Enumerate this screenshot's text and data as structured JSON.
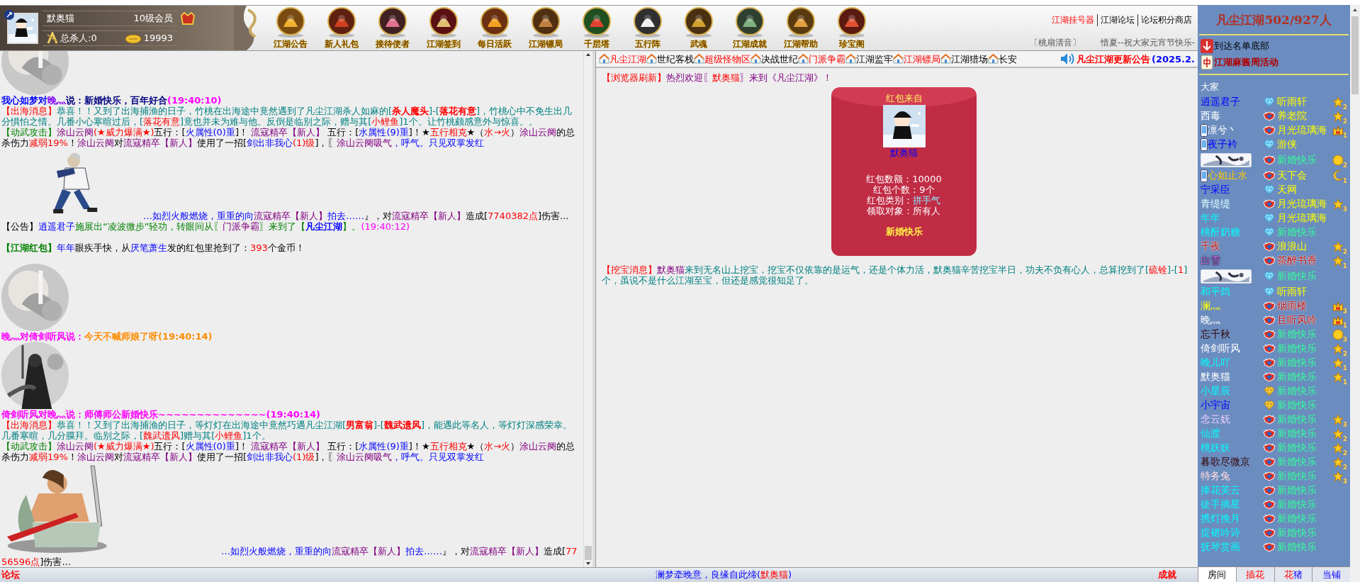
{
  "profile": {
    "name": "默奥猫",
    "level": "10级会员",
    "kills": "总杀人:0",
    "coins": "19993"
  },
  "menu": [
    {
      "label": "江湖公告"
    },
    {
      "label": "新人礼包"
    },
    {
      "label": "接待使者"
    },
    {
      "label": "江湖签到"
    },
    {
      "label": "每日活跃"
    },
    {
      "label": "江湖镖局"
    },
    {
      "label": "千层塔"
    },
    {
      "label": "五行阵"
    },
    {
      "label": "武魂"
    },
    {
      "label": "江湖成就"
    },
    {
      "label": "江湖帮助"
    },
    {
      "label": "珍宝阁"
    }
  ],
  "top_links": [
    {
      "label": "江湖挂号器",
      "kind": "hot"
    },
    {
      "label": "江湖论坛",
      "kind": "plain"
    },
    {
      "label": "论坛积分商店",
      "kind": "plain"
    }
  ],
  "music": "〔桃扇清音〕",
  "marquee": "惜夏--祝大家元宵节快乐-",
  "chat": [
    {
      "kind": "speech",
      "avatar": true,
      "segments": [
        {
          "text": "我心如梦对",
          "kind": "detail"
        },
        {
          "text": "晚灬",
          "kind": "rival"
        },
        {
          "text": "说：新婚快乐，百年好合",
          "kind": "speech"
        },
        {
          "text": "(19:40:10)",
          "kind": "stamp"
        }
      ]
    },
    {
      "kind": "line",
      "segments": [
        {
          "text": "【出海消息】",
          "kind": "alert"
        },
        {
          "text": "恭喜！！又到了出海捕渔的日子，竹桃在出海途中竟然遇到了凡尘江湖杀人如麻的[",
          "kind": "story"
        },
        {
          "text": "杀人魔头",
          "kind": "alert",
          "bold": true
        },
        {
          "text": "]-[",
          "kind": "story"
        },
        {
          "text": "落花有意",
          "kind": "alert",
          "bold": true
        },
        {
          "text": "]，竹桃心中不免生出几分惧怕之情。几番小心寒暄过后，[",
          "kind": "story"
        },
        {
          "text": "落花有意",
          "kind": "alert"
        },
        {
          "text": "]竟也并未为难与他。反倒是临别之际，赠与其[",
          "kind": "story"
        },
        {
          "text": "小鲤鱼",
          "kind": "alert"
        },
        {
          "text": "]1个。让竹桃颇感意外与惊喜。。",
          "kind": "story"
        }
      ]
    },
    {
      "kind": "line",
      "segments": [
        {
          "text": "【动武攻击】",
          "kind": "notice"
        },
        {
          "text": "涂山云阕",
          "kind": "person"
        },
        {
          "text": "(★威力爆满★)",
          "kind": "alert"
        },
        {
          "text": "五行：[",
          "kind": "plain"
        },
        {
          "text": "火属性(0)重",
          "kind": "detail"
        },
        {
          "text": "]！ ",
          "kind": "plain"
        },
        {
          "text": "流寇精卒【新人】",
          "kind": "person"
        },
        {
          "text": " 五行：[",
          "kind": "plain"
        },
        {
          "text": "水属性(9)重",
          "kind": "detail"
        },
        {
          "text": "]！★",
          "kind": "plain"
        },
        {
          "text": "五行相克",
          "kind": "alert"
        },
        {
          "text": "★（",
          "kind": "plain"
        },
        {
          "text": "水→火",
          "kind": "alert"
        },
        {
          "text": "）",
          "kind": "plain"
        },
        {
          "text": "涂山云阕",
          "kind": "person"
        },
        {
          "text": "的总杀伤力",
          "kind": "plain"
        },
        {
          "text": "减弱19%",
          "kind": "alert"
        },
        {
          "text": "！",
          "kind": "plain"
        },
        {
          "text": "涂山云阕",
          "kind": "person"
        },
        {
          "text": "对",
          "kind": "plain"
        },
        {
          "text": "流寇精卒【新人】",
          "kind": "person"
        },
        {
          "text": "使用了一招[",
          "kind": "plain"
        },
        {
          "text": "剑出非我心",
          "kind": "detail"
        },
        {
          "text": "(1)级",
          "kind": "alert"
        },
        {
          "text": "]，〖",
          "kind": "plain"
        },
        {
          "text": "涂山云阕吸气",
          "kind": "person"
        },
        {
          "text": "，呼气。只见双掌发红",
          "kind": "detail"
        }
      ]
    },
    {
      "kind": "attack",
      "segments": [
        {
          "text": "…如烈火般燃烧，重重的向",
          "kind": "detail"
        },
        {
          "text": "流寇精卒【新人】",
          "kind": "person"
        },
        {
          "text": "拍去……",
          "kind": "detail"
        },
        {
          "text": "』，对",
          "kind": "plain"
        },
        {
          "text": "流寇精卒【新人】",
          "kind": "person"
        },
        {
          "text": "造成[",
          "kind": "plain"
        },
        {
          "text": "7740382点",
          "kind": "alert"
        },
        {
          "text": "]伤害...",
          "kind": "plain"
        }
      ]
    },
    {
      "kind": "line",
      "segments": [
        {
          "text": "【公告】",
          "kind": "plain"
        },
        {
          "text": "逍遥君子",
          "kind": "detail"
        },
        {
          "text": "施展出“凌波微步”轻功，转眼间从〖",
          "kind": "notice"
        },
        {
          "text": "门派争霸",
          "kind": "person"
        },
        {
          "text": "〗来到了【",
          "kind": "notice"
        },
        {
          "text": "凡尘江湖",
          "kind": "detail",
          "bold": true
        },
        {
          "text": "】。",
          "kind": "notice"
        },
        {
          "text": "(19:40:12)",
          "kind": "stamp"
        }
      ]
    },
    {
      "kind": "bonus",
      "segments": [
        {
          "text": "【江湖红包】",
          "kind": "notice",
          "bold": true
        },
        {
          "text": "年年",
          "kind": "detail"
        },
        {
          "text": "眼疾手快，从",
          "kind": "plain"
        },
        {
          "text": "厌笔萧生",
          "kind": "detail"
        },
        {
          "text": "发的红包里抢到了：",
          "kind": "plain"
        },
        {
          "text": "393",
          "kind": "alert"
        },
        {
          "text": "个金币！",
          "kind": "plain"
        }
      ]
    },
    {
      "kind": "speech",
      "avatar": true,
      "segments": [
        {
          "text": "晚灬对倚剑听风说：",
          "kind": "stamp"
        },
        {
          "text": "今天不喊师娘了呀(19:40:14)",
          "kind": "hint"
        }
      ]
    },
    {
      "kind": "speech",
      "avatar": true,
      "segments": [
        {
          "text": "倚剑听风对晚灬说：师傅师公新婚快乐~~~~~~~~~~~~~~(19:40:14)",
          "kind": "stamp"
        }
      ]
    },
    {
      "kind": "line",
      "segments": [
        {
          "text": "【出海消息】",
          "kind": "alert"
        },
        {
          "text": "恭喜！！又到了出海捕渔的日子，等灯灯在出海途中竟然巧遇凡尘江湖[",
          "kind": "story"
        },
        {
          "text": "男富翁",
          "kind": "alert",
          "bold": true
        },
        {
          "text": "]-[",
          "kind": "story"
        },
        {
          "text": "魏武遗风",
          "kind": "alert",
          "bold": true
        },
        {
          "text": "]，能遇此等名人，等灯灯深感荣幸。几番寒暄，几分膜拜。临别之际，[",
          "kind": "story"
        },
        {
          "text": "魏武遗风",
          "kind": "alert"
        },
        {
          "text": "]赠与其[",
          "kind": "story"
        },
        {
          "text": "小鲤鱼",
          "kind": "alert"
        },
        {
          "text": "]1个。",
          "kind": "story"
        }
      ]
    },
    {
      "kind": "line",
      "segments": [
        {
          "text": "【动武攻击】",
          "kind": "notice"
        },
        {
          "text": "涂山云阕",
          "kind": "person"
        },
        {
          "text": "(★威力爆满★)",
          "kind": "alert"
        },
        {
          "text": "五行：[",
          "kind": "plain"
        },
        {
          "text": "火属性(0)重",
          "kind": "detail"
        },
        {
          "text": "]！ ",
          "kind": "plain"
        },
        {
          "text": "流寇精卒【新人】",
          "kind": "person"
        },
        {
          "text": " 五行：[",
          "kind": "plain"
        },
        {
          "text": "水属性(9)重",
          "kind": "detail"
        },
        {
          "text": "]！★",
          "kind": "plain"
        },
        {
          "text": "五行相克",
          "kind": "alert"
        },
        {
          "text": "★（",
          "kind": "plain"
        },
        {
          "text": "水→火",
          "kind": "alert"
        },
        {
          "text": "）",
          "kind": "plain"
        },
        {
          "text": "涂山云阕",
          "kind": "person"
        },
        {
          "text": "的总杀伤力",
          "kind": "plain"
        },
        {
          "text": "减弱19%",
          "kind": "alert"
        },
        {
          "text": "！",
          "kind": "plain"
        },
        {
          "text": "涂山云阕",
          "kind": "person"
        },
        {
          "text": "对",
          "kind": "plain"
        },
        {
          "text": "流寇精卒【新人】",
          "kind": "person"
        },
        {
          "text": "使用了一招[",
          "kind": "plain"
        },
        {
          "text": "剑出非我心",
          "kind": "detail"
        },
        {
          "text": "(1)级",
          "kind": "alert"
        },
        {
          "text": "]，〖",
          "kind": "plain"
        },
        {
          "text": "涂山云阕吸气",
          "kind": "person"
        },
        {
          "text": "，呼气。只见双掌发红",
          "kind": "detail"
        }
      ]
    },
    {
      "kind": "attack",
      "segments": [
        {
          "text": "…如烈火般燃烧，重重的向",
          "kind": "detail"
        },
        {
          "text": "流寇精卒【新人】",
          "kind": "person"
        },
        {
          "text": "拍去……",
          "kind": "detail"
        },
        {
          "text": "』，对",
          "kind": "plain"
        },
        {
          "text": "流寇精卒【新人】",
          "kind": "person"
        },
        {
          "text": "造成[",
          "kind": "plain"
        },
        {
          "text": "7756596点",
          "kind": "alert"
        },
        {
          "text": "]伤害...",
          "kind": "plain"
        }
      ]
    }
  ],
  "rooms": [
    {
      "label": "凡尘江湖",
      "kind": "hot"
    },
    {
      "label": "世纪客栈",
      "kind": "plain"
    },
    {
      "label": "超级怪物区",
      "kind": "hot"
    },
    {
      "label": "决战世纪",
      "kind": "plain"
    },
    {
      "label": "门派争霸",
      "kind": "hot"
    },
    {
      "label": "江湖监牢",
      "kind": "plain"
    },
    {
      "label": "江湖镖局",
      "kind": "hot"
    },
    {
      "label": "江湖猎场",
      "kind": "plain"
    },
    {
      "label": "长安",
      "kind": "plain"
    }
  ],
  "notice": {
    "title": "凡尘江湖更新公告",
    "date": "(2025.2."
  },
  "hall": [
    {
      "kind": "line",
      "segments": [
        {
          "text": "【浏览器刷新】",
          "kind": "alert"
        },
        {
          "text": "热烈欢迎〖",
          "kind": "person"
        },
        {
          "text": "默奥猫",
          "kind": "alert"
        },
        {
          "text": "〗来到《凡尘江湖》！",
          "kind": "person"
        }
      ]
    },
    {
      "kind": "redpacket",
      "heading": "红包来自",
      "sender": "默奥猫",
      "details": [
        {
          "label": "红包数额：",
          "value": "10000",
          "highlight": false
        },
        {
          "label": "红包个数：",
          "value": "9个",
          "highlight": false
        },
        {
          "label": "红包类别：",
          "value": "拼手气",
          "highlight": true
        },
        {
          "label": "领取对象：",
          "value": "所有人",
          "highlight": false
        }
      ],
      "greeting": "新婚快乐"
    },
    {
      "kind": "line",
      "segments": [
        {
          "text": "【挖宝消息】",
          "kind": "alert"
        },
        {
          "text": "默奥猫",
          "kind": "person"
        },
        {
          "text": "来到无名山上挖宝，挖宝不仅依靠的是运气，还是个体力活，默奥猫辛苦挖宝半日，功夫不负有心人，总算挖到了[",
          "kind": "story"
        },
        {
          "text": "硫铨",
          "kind": "alert"
        },
        {
          "text": "]-[",
          "kind": "story"
        },
        {
          "text": "1",
          "kind": "alert"
        },
        {
          "text": "]个，虽说不是什么江湖至宝，但还是感觉很知足了。",
          "kind": "story"
        }
      ]
    }
  ],
  "roster": {
    "title": "凡尘江湖502/927人",
    "actions": [
      {
        "kind": "down",
        "label": "到达名单底部"
      },
      {
        "kind": "tile",
        "label": "江湖麻酱周活动"
      }
    ],
    "group": "大家"
  },
  "users": [
    {
      "kind": "user",
      "name": "逍遥君子",
      "color": "#0000ff",
      "gem": {
        "kind": "diamond"
      },
      "team": {
        "name": "听雨轩",
        "color": "#ffff00"
      },
      "badge": {
        "kind": "star",
        "count": "2"
      }
    },
    {
      "kind": "user",
      "name": "西毒",
      "color": "#ffffff",
      "gem": {
        "kind": "shield"
      },
      "team": {
        "name": "养老院",
        "color": "#ffff00"
      },
      "badge": {
        "kind": "star",
        "count": "2"
      }
    },
    {
      "kind": "user",
      "name": "凛兮丶",
      "color": "#ffffff",
      "phone": true,
      "gem": {
        "kind": "shield"
      },
      "team": {
        "name": "月光琉璃海",
        "color": "#ffff00"
      },
      "badge": {
        "kind": "crown",
        "count": "1"
      }
    },
    {
      "kind": "user",
      "name": "夜子衿",
      "color": "#0000ff",
      "phone": true,
      "gem": {
        "kind": "diamond"
      },
      "team": {
        "name": "游侠",
        "color": "#ffff00"
      }
    },
    {
      "kind": "picture",
      "gem": {
        "kind": "shield"
      },
      "team": {
        "name": "新婚快乐",
        "color": "#33ff99"
      },
      "badge": {
        "kind": "round",
        "count": "2"
      }
    },
    {
      "kind": "user",
      "name": "心如止水",
      "color": "#ffcc00",
      "phone": true,
      "gem": {
        "kind": "shield"
      },
      "team": {
        "name": "天下会",
        "color": "#ffff00"
      },
      "badge": {
        "kind": "moon",
        "count": "1"
      }
    },
    {
      "kind": "user",
      "name": "宁采臣",
      "color": "#0000ff",
      "gem": {
        "kind": "diamond"
      },
      "team": {
        "name": "天网",
        "color": "#ffff00"
      }
    },
    {
      "kind": "user",
      "name": "青缇缇",
      "color": "#ddffff",
      "gem": {
        "kind": "shield"
      },
      "team": {
        "name": "月光琉璃海",
        "color": "#ffff00"
      },
      "badge": {
        "kind": "star",
        "count": "3"
      }
    },
    {
      "kind": "user",
      "name": "年年",
      "color": "#00ffff",
      "gem": {
        "kind": "diamond"
      },
      "team": {
        "name": "月光琉璃海",
        "color": "#ffff00"
      }
    },
    {
      "kind": "user",
      "name": "桃酐奶糖",
      "color": "#00ffff",
      "gem": {
        "kind": "diamond"
      },
      "team": {
        "name": "新婚快乐",
        "color": "#33ff99"
      }
    },
    {
      "kind": "user",
      "name": "千夜",
      "color": "#b00000",
      "gem": {
        "kind": "shield"
      },
      "team": {
        "name": "浪浪山",
        "color": "#ffff00"
      },
      "badge": {
        "kind": "star",
        "count": "2"
      }
    },
    {
      "kind": "user",
      "name": "白雪",
      "color": "#cc77ff",
      "gem": {
        "kind": "shield"
      },
      "team": {
        "name": "茶醉书香",
        "color": "#b00000"
      },
      "badge": {
        "kind": "star",
        "count": "1"
      }
    },
    {
      "kind": "picture",
      "gem": {
        "kind": "diamond"
      },
      "team": {
        "name": "新婚快乐",
        "color": "#33ff99"
      }
    },
    {
      "kind": "user",
      "name": "和平鸽",
      "color": "#00ffff",
      "gem": {
        "kind": "diamond"
      },
      "team": {
        "name": "听雨轩",
        "color": "#ffff00"
      }
    },
    {
      "kind": "user",
      "name": "澜灬",
      "color": "#ffff00",
      "gem": {
        "kind": "shield"
      },
      "team": {
        "name": "烟雨楼",
        "color": "#b00000"
      },
      "badge": {
        "kind": "crown",
        "count": "3"
      }
    },
    {
      "kind": "user",
      "name": "晚灬",
      "color": "#ffffff",
      "gem": {
        "kind": "shield"
      },
      "team": {
        "name": "且听风吟",
        "color": "#b00000"
      },
      "badge": {
        "kind": "crown",
        "count": "1"
      }
    },
    {
      "kind": "user",
      "name": "忘千秋",
      "color": "#330000",
      "gem": {
        "kind": "shield"
      },
      "team": {
        "name": "新婚快乐",
        "color": "#33ff99"
      },
      "badge": {
        "kind": "round",
        "count": "3"
      }
    },
    {
      "kind": "user",
      "name": "倚剑听风",
      "color": "#ffffff",
      "gem": {
        "kind": "shield"
      },
      "team": {
        "name": "新婚快乐",
        "color": "#33ff99"
      },
      "badge": {
        "kind": "star",
        "count": "2"
      }
    },
    {
      "kind": "user",
      "name": "晚儿吖",
      "color": "#00ffff",
      "gem": {
        "kind": "shield"
      },
      "team": {
        "name": "新婚快乐",
        "color": "#33ff99"
      },
      "badge": {
        "kind": "star",
        "count": "1"
      }
    },
    {
      "kind": "user",
      "name": "默奥猫",
      "color": "#ffffff",
      "gem": {
        "kind": "shield"
      },
      "team": {
        "name": "新婚快乐",
        "color": "#33ff99"
      },
      "badge": {
        "kind": "star",
        "count": "1"
      }
    },
    {
      "kind": "user",
      "name": "小星辰",
      "color": "#00ffff",
      "gem": {
        "kind": "gold"
      },
      "team": {
        "name": "新婚快乐",
        "color": "#33ff99"
      }
    },
    {
      "kind": "user",
      "name": "小宇宙",
      "color": "#0000ff",
      "gem": {
        "kind": "gold"
      },
      "team": {
        "name": "新婚快乐",
        "color": "#33ff99"
      }
    },
    {
      "kind": "user",
      "name": "念云妩",
      "color": "#eeccff",
      "gem": {
        "kind": "shield"
      },
      "team": {
        "name": "新婚快乐",
        "color": "#33ff99"
      },
      "badge": {
        "kind": "star",
        "count": "3"
      }
    },
    {
      "kind": "user",
      "name": "仙渡",
      "color": "#00ffff",
      "gem": {
        "kind": "shield"
      },
      "team": {
        "name": "新婚快乐",
        "color": "#33ff99"
      },
      "badge": {
        "kind": "star",
        "count": "2"
      }
    },
    {
      "kind": "user",
      "name": "桃妖妖",
      "color": "#00ffff",
      "gem": {
        "kind": "shield"
      },
      "team": {
        "name": "新婚快乐",
        "color": "#33ff99"
      },
      "badge": {
        "kind": "star",
        "count": "2"
      }
    },
    {
      "kind": "user",
      "name": "暮歌尽微京",
      "color": "#330000",
      "gem": {
        "kind": "shield"
      },
      "team": {
        "name": "新婚快乐",
        "color": "#33ff99"
      },
      "badge": {
        "kind": "star",
        "count": "2"
      }
    },
    {
      "kind": "user",
      "name": "特务兔",
      "color": "#ffdddd",
      "gem": {
        "kind": "shield"
      },
      "team": {
        "name": "新婚快乐",
        "color": "#33ff99"
      },
      "badge": {
        "kind": "star",
        "count": "3"
      }
    },
    {
      "kind": "user",
      "name": "捧花芙云",
      "color": "#00ffff",
      "gem": {
        "kind": "shield"
      },
      "team": {
        "name": "新婚快乐",
        "color": "#33ff99"
      }
    },
    {
      "kind": "user",
      "name": "徒手摘星",
      "color": "#00ffff",
      "gem": {
        "kind": "shield"
      },
      "team": {
        "name": "新婚快乐",
        "color": "#33ff99"
      }
    },
    {
      "kind": "user",
      "name": "携灯挽月",
      "color": "#00ffff",
      "gem": {
        "kind": "shield"
      },
      "team": {
        "name": "新婚快乐",
        "color": "#33ff99"
      }
    },
    {
      "kind": "user",
      "name": "提裙吟诗",
      "color": "#00ffff",
      "gem": {
        "kind": "shield"
      },
      "team": {
        "name": "新婚快乐",
        "color": "#33ff99"
      }
    },
    {
      "kind": "user",
      "name": "抚琴赏画",
      "color": "#00ffff",
      "gem": {
        "kind": "shield"
      },
      "team": {
        "name": "新婚快乐",
        "color": "#33ff99"
      }
    }
  ],
  "roster_tabs": [
    {
      "selected": true,
      "parts": [
        {
          "text": "房间",
          "kind": "plain"
        }
      ]
    },
    {
      "selected": false,
      "parts": [
        {
          "text": "插花",
          "kind": "alert"
        }
      ]
    },
    {
      "selected": false,
      "parts": [
        {
          "text": "花",
          "kind": "alert"
        },
        {
          "text": "猪",
          "kind": "detail"
        }
      ]
    },
    {
      "selected": false,
      "parts": [
        {
          "text": "当铺",
          "kind": "detail"
        }
      ]
    }
  ],
  "footer": {
    "left": "论坛",
    "center": [
      {
        "text": "澜梦牵晚意，良缘自此缔(",
        "kind": "detail"
      },
      {
        "text": "默奥猫",
        "kind": "alert"
      },
      {
        "text": ")",
        "kind": "detail"
      }
    ],
    "right": "成就"
  }
}
